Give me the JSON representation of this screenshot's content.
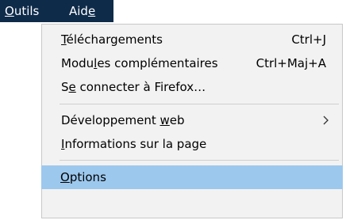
{
  "menubar": {
    "items": [
      {
        "label_pre": "",
        "mnemonic": "O",
        "label_post": "utils"
      },
      {
        "label_pre": "Aid",
        "mnemonic": "e",
        "label_post": ""
      }
    ]
  },
  "menu": {
    "items": [
      {
        "label_pre": "",
        "mnemonic": "T",
        "label_post": "éléchargements",
        "shortcut": "Ctrl+J"
      },
      {
        "label_pre": "Modu",
        "mnemonic": "l",
        "label_post": "es complémentaires",
        "shortcut": "Ctrl+Maj+A"
      },
      {
        "label_pre": "S",
        "mnemonic": "e",
        "label_post": " connecter à Firefox…"
      },
      {
        "label_pre": "Développement ",
        "mnemonic": "w",
        "label_post": "eb",
        "submenu_icon": "chevron-right-icon"
      },
      {
        "label_pre": "",
        "mnemonic": "I",
        "label_post": "nformations sur la page"
      },
      {
        "label_pre": "",
        "mnemonic": "O",
        "label_post": "ptions"
      }
    ]
  },
  "colors": {
    "menubar_active_bg": "#0f2b4a",
    "menu_bg": "#f2f2f2",
    "highlight_bg": "#9dc8ee"
  }
}
